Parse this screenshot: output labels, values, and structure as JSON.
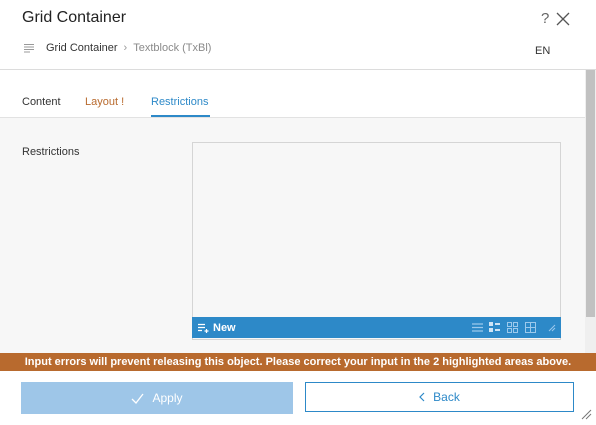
{
  "header": {
    "title": "Grid Container",
    "help": "?",
    "language": "EN"
  },
  "breadcrumb": {
    "items": [
      "Grid Container",
      "Textblock (TxBl)"
    ],
    "separator": "›"
  },
  "tabs": [
    {
      "label": "Content"
    },
    {
      "label": "Layout !"
    },
    {
      "label": "Restrictions"
    }
  ],
  "form": {
    "restrictions_label": "Restrictions"
  },
  "editor": {
    "new_label": "New"
  },
  "error": {
    "message": "Input errors will prevent releasing this object. Please correct your input in the 2 highlighted areas above."
  },
  "footer": {
    "apply_label": "Apply",
    "back_label": "Back"
  },
  "colors": {
    "accent": "#2d89c8",
    "error": "#b86a2e",
    "apply_disabled": "#9ec6e8"
  }
}
